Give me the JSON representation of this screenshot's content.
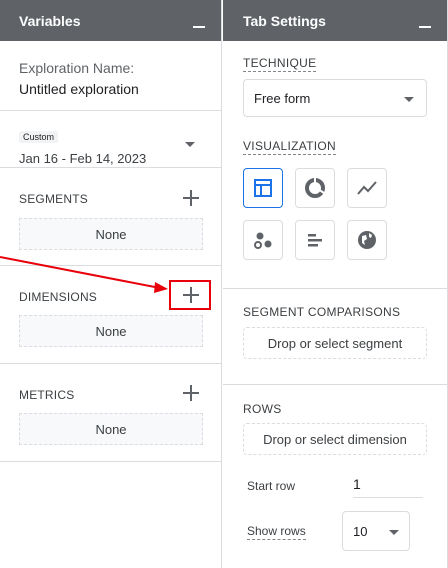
{
  "variables_panel": {
    "title": "Variables",
    "exploration_name_label": "Exploration Name:",
    "exploration_name_value": "Untitled exploration",
    "date_chip": "Custom",
    "date_range": "Jan 16 - Feb 14, 2023",
    "segments": {
      "title": "SEGMENTS",
      "empty": "None"
    },
    "dimensions": {
      "title": "DIMENSIONS",
      "empty": "None"
    },
    "metrics": {
      "title": "METRICS",
      "empty": "None"
    }
  },
  "tab_settings": {
    "title": "Tab Settings",
    "technique": {
      "label": "TECHNIQUE",
      "value": "Free form"
    },
    "visualization": {
      "label": "VISUALIZATION",
      "options": [
        "table-icon",
        "donut-chart-icon",
        "line-chart-icon",
        "scatter-plot-icon",
        "bar-chart-icon",
        "geo-map-icon"
      ],
      "active_index": 0
    },
    "segment_comparisons": {
      "label": "SEGMENT COMPARISONS",
      "drop_text": "Drop or select segment"
    },
    "rows": {
      "label": "ROWS",
      "drop_text": "Drop or select dimension",
      "start_row_label": "Start row",
      "start_row_value": "1",
      "show_rows_label": "Show rows",
      "show_rows_value": "10"
    }
  },
  "annotation": {
    "color": "#e8000b"
  },
  "colors": {
    "header_bg": "#5f6368",
    "active_blue": "#1a73e8"
  }
}
